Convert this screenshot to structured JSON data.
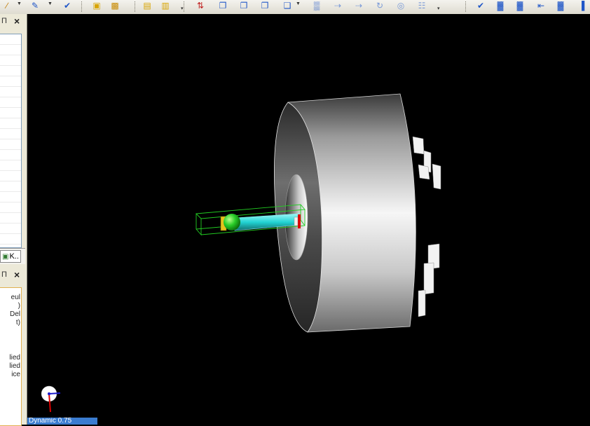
{
  "toolbar": {
    "icons": [
      "wand-icon",
      "pen-tool-icon",
      "check-pen-icon",
      "pencil-box-icon",
      "paint-bucket-icon",
      "open-folder-icon",
      "folder-arrow-icon",
      "sort-icon",
      "box-arrow-icon",
      "box-up-icon",
      "box-down-icon",
      "box-tree-icon",
      "grid-icon",
      "arrow-dash-icon",
      "arrow-dash-2-icon",
      "rotate-icon",
      "target-icon",
      "cabinet-icon",
      "check-icon",
      "chart-check-icon",
      "chart-arrow-icon",
      "chart-left-icon",
      "chart-box-icon",
      "chart-end-icon"
    ]
  },
  "left_panel": {
    "pin_glyph": "Π",
    "close_glyph": "×",
    "tab_label": "K..",
    "lower_lines": [
      "eul",
      ")",
      "Del",
      "t)",
      "lied",
      "lied",
      "ice"
    ]
  },
  "viewport": {
    "background": "#000000",
    "status_text": "Dynamic 0.75"
  },
  "colors": {
    "toolbar_bg": "#ece9d8",
    "accent_blue": "#3a7cd0",
    "wheel_light": "#f4f4f4",
    "wheel_dark": "#5a5a5a",
    "shaft_cyan": "#33dddd",
    "ball_green": "#22cc22",
    "bbox_green": "#22cc22",
    "axis_red": "#dd0000",
    "axis_blue": "#1a1acc"
  }
}
